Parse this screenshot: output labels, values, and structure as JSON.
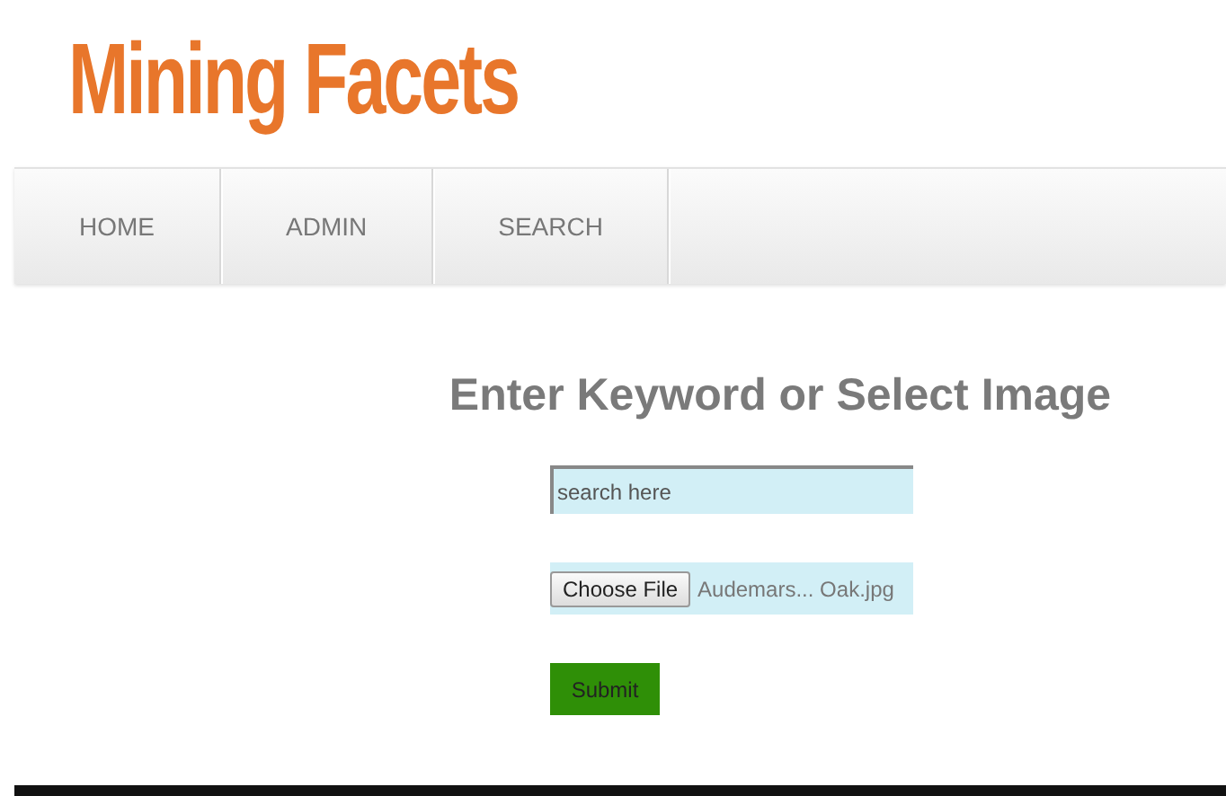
{
  "logo": {
    "text": "Mining Facets"
  },
  "nav": {
    "items": [
      {
        "label": "HOME"
      },
      {
        "label": "ADMIN"
      },
      {
        "label": "SEARCH"
      }
    ]
  },
  "form": {
    "heading": "Enter Keyword or Select Image",
    "search": {
      "placeholder": "search here"
    },
    "file": {
      "button": "Choose File",
      "filename": "Audemars... Oak.jpg"
    },
    "submit": "Submit"
  }
}
